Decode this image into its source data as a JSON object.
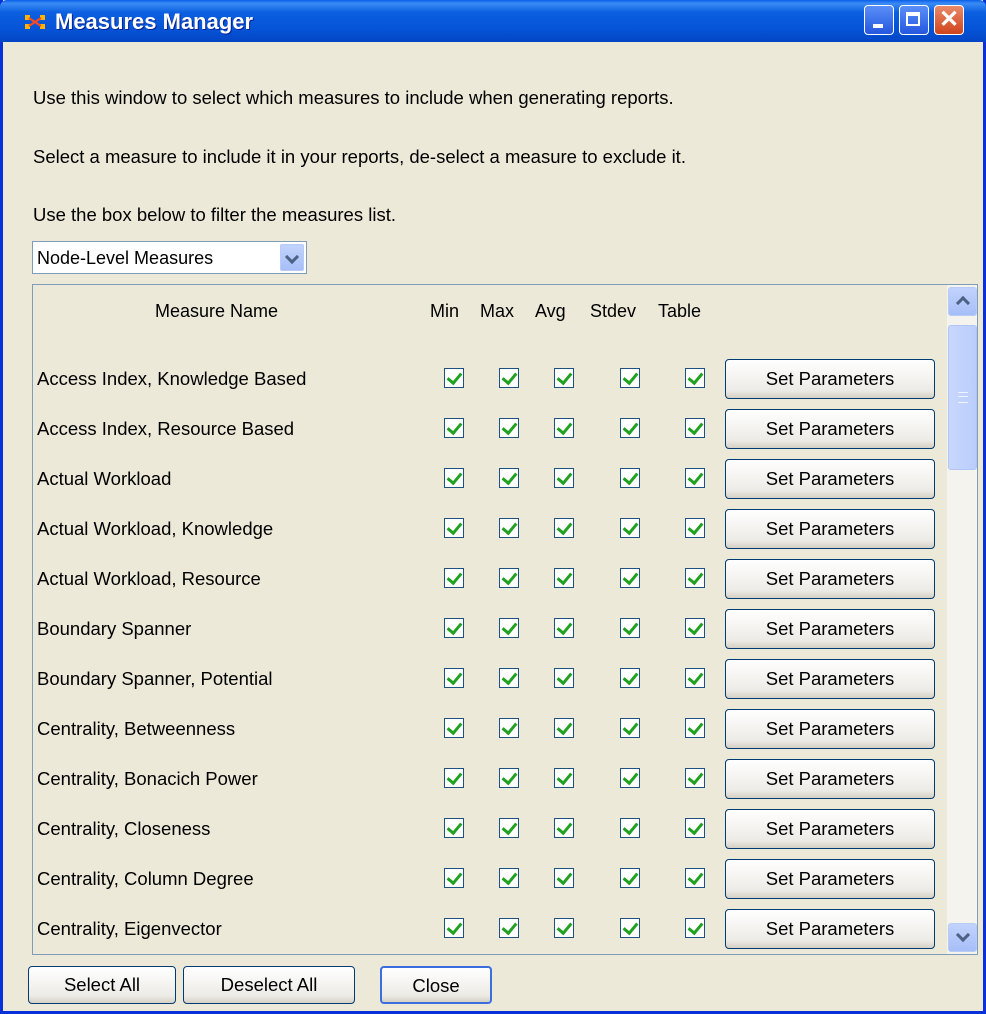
{
  "window": {
    "title": "Measures Manager"
  },
  "instructions": {
    "line1": "Use this window to select which measures to include when generating reports.",
    "line2": "Select a measure to include it in your reports, de-select a measure to exclude it.",
    "line3": "Use the box below to filter the measures list."
  },
  "filter": {
    "selected": "Node-Level Measures"
  },
  "table": {
    "headers": {
      "name": "Measure Name",
      "min": "Min",
      "max": "Max",
      "avg": "Avg",
      "stdev": "Stdev",
      "table": "Table"
    },
    "set_parameters_label": "Set Parameters",
    "rows": [
      {
        "name": "Access Index, Knowledge Based",
        "min": true,
        "max": true,
        "avg": true,
        "stdev": true,
        "table": true
      },
      {
        "name": "Access Index, Resource Based",
        "min": true,
        "max": true,
        "avg": true,
        "stdev": true,
        "table": true
      },
      {
        "name": "Actual Workload",
        "min": true,
        "max": true,
        "avg": true,
        "stdev": true,
        "table": true
      },
      {
        "name": "Actual Workload, Knowledge",
        "min": true,
        "max": true,
        "avg": true,
        "stdev": true,
        "table": true
      },
      {
        "name": "Actual Workload, Resource",
        "min": true,
        "max": true,
        "avg": true,
        "stdev": true,
        "table": true
      },
      {
        "name": "Boundary Spanner",
        "min": true,
        "max": true,
        "avg": true,
        "stdev": true,
        "table": true
      },
      {
        "name": "Boundary Spanner, Potential",
        "min": true,
        "max": true,
        "avg": true,
        "stdev": true,
        "table": true
      },
      {
        "name": "Centrality, Betweenness",
        "min": true,
        "max": true,
        "avg": true,
        "stdev": true,
        "table": true
      },
      {
        "name": "Centrality, Bonacich Power",
        "min": true,
        "max": true,
        "avg": true,
        "stdev": true,
        "table": true
      },
      {
        "name": "Centrality, Closeness",
        "min": true,
        "max": true,
        "avg": true,
        "stdev": true,
        "table": true
      },
      {
        "name": "Centrality, Column Degree",
        "min": true,
        "max": true,
        "avg": true,
        "stdev": true,
        "table": true
      },
      {
        "name": "Centrality, Eigenvector",
        "min": true,
        "max": true,
        "avg": true,
        "stdev": true,
        "table": true
      }
    ]
  },
  "footer": {
    "select_all": "Select All",
    "deselect_all": "Deselect All",
    "close": "Close"
  }
}
